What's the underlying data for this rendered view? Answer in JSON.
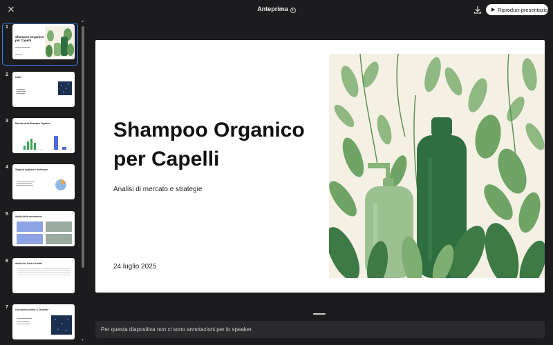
{
  "window": {
    "title": "Anteprima",
    "play_label": "Riproduci presentazione"
  },
  "icons": {
    "close": "close-icon",
    "info": "info-icon",
    "download": "download-icon",
    "play": "play-icon"
  },
  "thumbnails": [
    {
      "num": "1",
      "title": "Shampoo Organico per Capelli"
    },
    {
      "num": "2",
      "title": "Indice"
    },
    {
      "num": "3",
      "title": "Mercato dello Shampoo Organico"
    },
    {
      "num": "4",
      "title": "Target di pubblico e preferenze"
    },
    {
      "num": "5",
      "title": "Analisi della concorrenza"
    },
    {
      "num": "6",
      "title": "Analisi dei Costi e Profitti"
    },
    {
      "num": "7",
      "title": "Concorrenza online & Tendenze"
    }
  ],
  "slide": {
    "title": "Shampoo Organico per Capelli",
    "subtitle": "Analisi di mercato e strategie",
    "date": "24 luglio 2025"
  },
  "notes": {
    "text": "Per questa diapositiva non ci sono annotazioni per lo speaker."
  },
  "colors": {
    "accent": "#3b82f6",
    "background": "#1c1c1e",
    "notes_bg": "#2b2b2e",
    "leaf_dark": "#2f6e3e",
    "leaf_light": "#86b37a",
    "slide_bg_art": "#f4f1e4"
  }
}
